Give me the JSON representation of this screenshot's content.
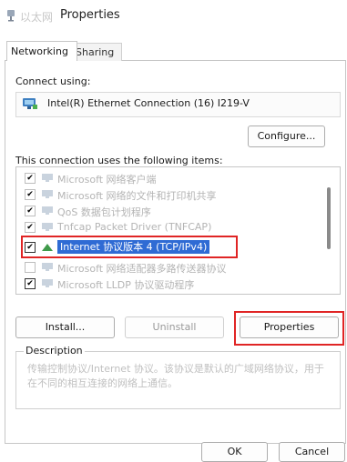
{
  "window": {
    "title_cn": "以太网",
    "title": "Properties"
  },
  "tabs": [
    {
      "label": "Networking",
      "selected": true
    },
    {
      "label": "Sharing",
      "selected": false
    }
  ],
  "connect": {
    "label": "Connect using:",
    "adapter_name": "Intel(R) Ethernet Connection (16) I219-V",
    "configure_label": "Configure..."
  },
  "items": {
    "label": "This connection uses the following items:",
    "rows": [
      {
        "label": "Microsoft 网络客户端",
        "checked": true,
        "faded": true
      },
      {
        "label": "Microsoft 网络的文件和打印机共享",
        "checked": true,
        "faded": true
      },
      {
        "label": "QoS 数据包计划程序",
        "checked": true,
        "faded": true
      },
      {
        "label": "Tnfcap Packet Driver (TNFCAP)",
        "checked": true,
        "faded": true
      },
      {
        "label": "Internet 协议版本 4 (TCP/IPv4)",
        "checked": true,
        "faded": false,
        "selected": true
      },
      {
        "label": "Microsoft 网络适配器多路传送器协议",
        "checked": false,
        "faded": true
      },
      {
        "label": "Microsoft LLDP 协议驱动程序",
        "checked": true,
        "faded": true
      }
    ]
  },
  "buttons": {
    "install": "Install...",
    "uninstall": "Uninstall",
    "properties": "Properties",
    "ok": "OK",
    "cancel": "Cancel"
  },
  "description": {
    "label": "Description",
    "text": "传输控制协议/Internet 协议。该协议是默认的广域网络协议，用于在不同的相互连接的网络上通信。"
  },
  "colors": {
    "selection": "#2f6bd4",
    "annotation_red": "#e02525"
  }
}
